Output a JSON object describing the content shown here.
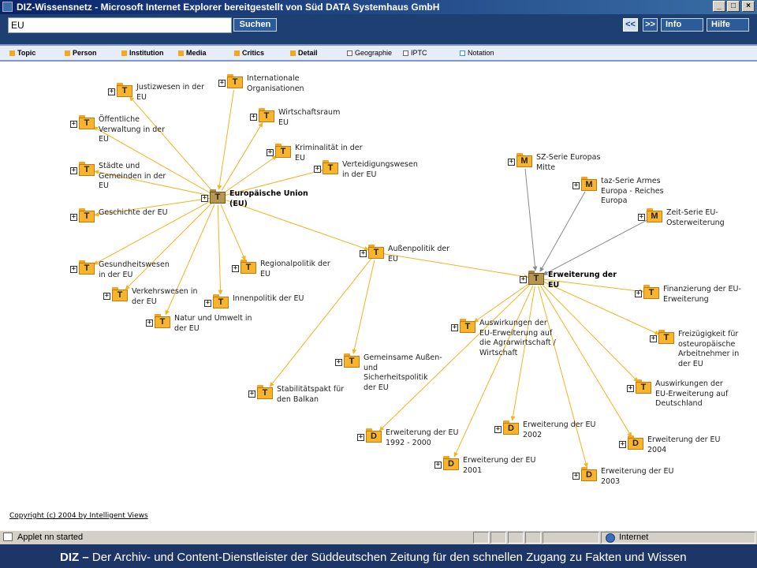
{
  "window": {
    "title": "DIZ-Wissensnetz - Microsoft Internet Explorer bereitgestellt von Süd DATA Systemhaus GmbH",
    "minimize_label": "_",
    "maximize_label": "□",
    "close_label": "×"
  },
  "search": {
    "value": "EU",
    "button_label": "Suchen"
  },
  "nav": {
    "back_label": "<<",
    "forward_label": ">>",
    "info_label": "Info",
    "help_label": "Hilfe"
  },
  "filters": [
    {
      "label": "Topic",
      "active": true
    },
    {
      "label": "Person",
      "active": true
    },
    {
      "label": "Institution",
      "active": true
    },
    {
      "label": "Media",
      "active": true
    },
    {
      "label": "Critics",
      "active": true
    },
    {
      "label": "Detail",
      "active": true
    },
    {
      "label": "Geographie",
      "active": false
    },
    {
      "label": "IPTC",
      "active": false
    },
    {
      "label": "Notation",
      "active": false
    }
  ],
  "graph": {
    "nodes": [
      {
        "id": "eu",
        "type": "T",
        "main": true,
        "label": [
          "Europäische Union",
          "(EU)"
        ]
      },
      {
        "id": "justiz",
        "type": "T",
        "label": [
          "Justizwesen in der",
          "EU"
        ]
      },
      {
        "id": "intorg",
        "type": "T",
        "label": [
          "Internationale",
          "Organisationen"
        ]
      },
      {
        "id": "verw",
        "type": "T",
        "label": [
          "Öffentliche",
          "Verwaltung in der",
          "EU"
        ]
      },
      {
        "id": "wirt",
        "type": "T",
        "label": [
          "Wirtschaftsraum",
          "EU"
        ]
      },
      {
        "id": "krim",
        "type": "T",
        "label": [
          "Kriminalität in der",
          "EU"
        ]
      },
      {
        "id": "staedte",
        "type": "T",
        "label": [
          "Städte und",
          "Gemeinden in der",
          "EU"
        ]
      },
      {
        "id": "vert",
        "type": "T",
        "label": [
          "Verteidigungswesen",
          "in der EU"
        ]
      },
      {
        "id": "gesch",
        "type": "T",
        "label": [
          "Geschichte der EU"
        ]
      },
      {
        "id": "gesund",
        "type": "T",
        "label": [
          "Gesundheitswesen",
          "in der EU"
        ]
      },
      {
        "id": "regio",
        "type": "T",
        "label": [
          "Regionalpolitik der",
          "EU"
        ]
      },
      {
        "id": "verkehr",
        "type": "T",
        "label": [
          "Verkehrswesen in",
          "der EU"
        ]
      },
      {
        "id": "innen",
        "type": "T",
        "label": [
          "Innenpolitik der EU"
        ]
      },
      {
        "id": "natur",
        "type": "T",
        "label": [
          "Natur und Umwelt in",
          "der EU"
        ]
      },
      {
        "id": "aussen",
        "type": "T",
        "label": [
          "Außenpolitik der",
          "EU"
        ]
      },
      {
        "id": "gasp",
        "type": "T",
        "label": [
          "Gemeinsame Außen-",
          "und",
          "Sicherheitspolitik",
          "der EU"
        ]
      },
      {
        "id": "stab",
        "type": "T",
        "label": [
          "Stabilitätspakt für",
          "den Balkan"
        ]
      },
      {
        "id": "sz",
        "type": "M",
        "label": [
          "SZ-Serie Europas",
          "Mitte"
        ]
      },
      {
        "id": "taz",
        "type": "M",
        "label": [
          "taz-Serie Armes",
          "Europa - Reiches",
          "Europa"
        ]
      },
      {
        "id": "zeit",
        "type": "M",
        "label": [
          "Zeit-Serie EU-",
          "Osterweiterung"
        ]
      },
      {
        "id": "erw",
        "type": "T",
        "main": true,
        "label": [
          "Erweiterung der",
          "EU"
        ]
      },
      {
        "id": "fin",
        "type": "T",
        "label": [
          "Finanzierung der EU-",
          "Erweiterung"
        ]
      },
      {
        "id": "agrar",
        "type": "T",
        "label": [
          "Auswirkungen der",
          "EU-Erweiterung auf",
          "die Agrarwirtschaft /",
          "Wirtschaft"
        ]
      },
      {
        "id": "frei",
        "type": "T",
        "label": [
          "Freizügigkeit für",
          "osteuropäische",
          "Arbeitnehmer in",
          "der EU"
        ]
      },
      {
        "id": "deutsch",
        "type": "T",
        "label": [
          "Auswirkungen der",
          "EU-Erweiterung auf",
          "Deutschland"
        ]
      },
      {
        "id": "e9200",
        "type": "D",
        "label": [
          "Erweiterung der EU",
          "1992 - 2000"
        ]
      },
      {
        "id": "e2002",
        "type": "D",
        "label": [
          "Erweiterung der EU",
          "2002"
        ]
      },
      {
        "id": "e2004",
        "type": "D",
        "label": [
          "Erweiterung der EU",
          "2004"
        ]
      },
      {
        "id": "e2001",
        "type": "D",
        "label": [
          "Erweiterung der EU",
          "2001"
        ]
      },
      {
        "id": "e2003",
        "type": "D",
        "label": [
          "Erweiterung der EU",
          "2003"
        ]
      }
    ],
    "edges": [
      [
        "eu",
        "justiz"
      ],
      [
        "intorg",
        "eu"
      ],
      [
        "eu",
        "verw"
      ],
      [
        "eu",
        "wirt"
      ],
      [
        "eu",
        "krim"
      ],
      [
        "eu",
        "staedte"
      ],
      [
        "eu",
        "vert"
      ],
      [
        "eu",
        "gesch"
      ],
      [
        "eu",
        "gesund"
      ],
      [
        "eu",
        "regio"
      ],
      [
        "eu",
        "verkehr"
      ],
      [
        "eu",
        "innen"
      ],
      [
        "eu",
        "natur"
      ],
      [
        "eu",
        "aussen"
      ],
      [
        "aussen",
        "erw"
      ],
      [
        "aussen",
        "gasp"
      ],
      [
        "aussen",
        "stab"
      ],
      [
        "sz",
        "erw"
      ],
      [
        "taz",
        "erw"
      ],
      [
        "zeit",
        "erw"
      ],
      [
        "erw",
        "fin"
      ],
      [
        "erw",
        "agrar"
      ],
      [
        "erw",
        "frei"
      ],
      [
        "erw",
        "deutsch"
      ],
      [
        "erw",
        "e9200"
      ],
      [
        "erw",
        "e2002"
      ],
      [
        "erw",
        "e2004"
      ],
      [
        "erw",
        "e2001"
      ],
      [
        "erw",
        "e2003"
      ]
    ],
    "colors": {
      "topic_edge": "#f6b21f",
      "media_edge": "#8a8a8a",
      "topic_icon": "#f8b52b",
      "main_icon": "#b89650"
    }
  },
  "copyright": "Copyright (c) 2004 by Intelligent Views",
  "status": {
    "text": "Applet nn started",
    "zone": "Internet"
  },
  "footer": {
    "brand": "DIZ –",
    "slogan": "Der Archiv- und Content-Dienstleister der Süddeutschen Zeitung für den schnellen Zugang zu Fakten und Wissen"
  }
}
